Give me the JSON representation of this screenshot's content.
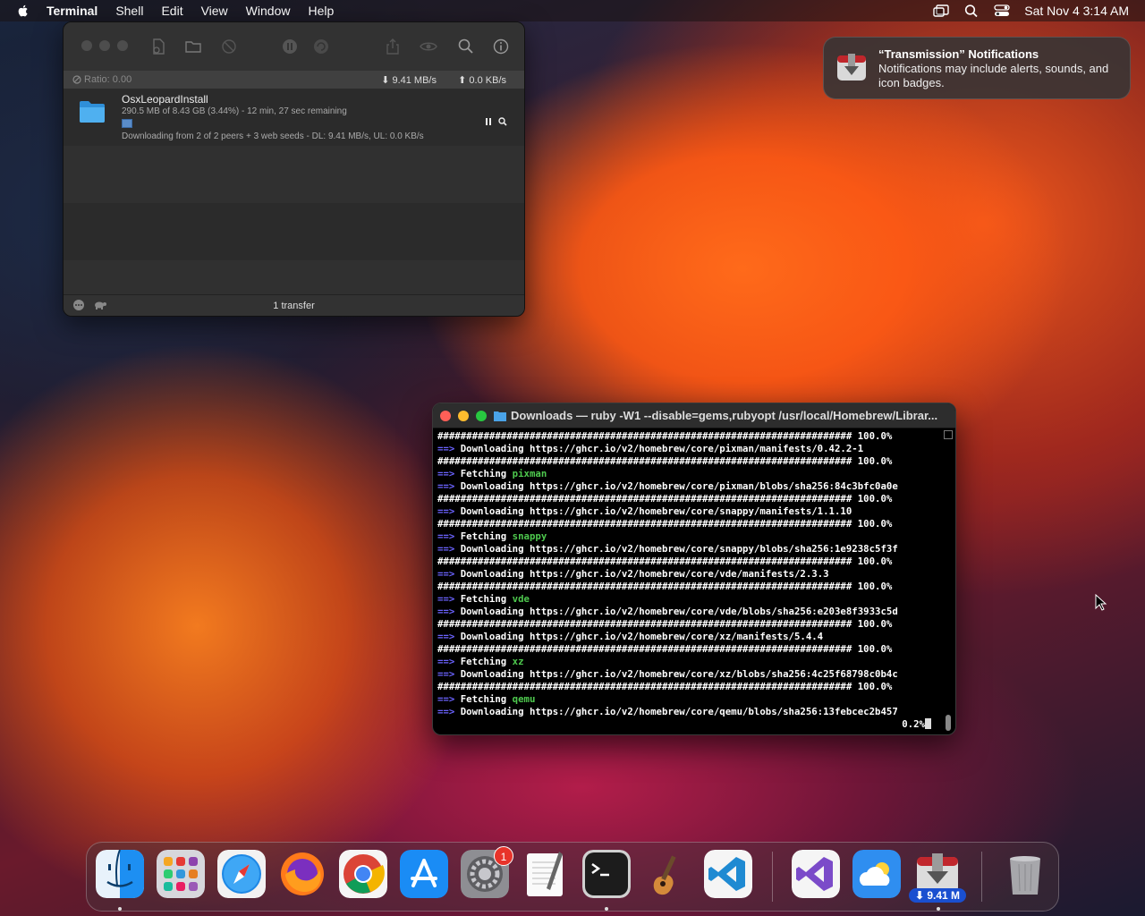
{
  "menubar": {
    "app_name": "Terminal",
    "menus": [
      "Shell",
      "Edit",
      "View",
      "Window",
      "Help"
    ],
    "datetime": "Sat Nov 4  3:14 AM"
  },
  "transmission": {
    "ratio": "Ratio: 0.00",
    "download_speed": "9.41 MB/s",
    "upload_speed": "0.0 KB/s",
    "torrent": {
      "name": "OsxLeopardInstall",
      "progress_text": "290.5 MB of 8.43 GB (3.44%) - 12 min, 27 sec remaining",
      "progress_fraction": 0.0344,
      "status_text": "Downloading from 2 of 2 peers + 3 web seeds - DL: 9.41 MB/s, UL: 0.0 KB/s"
    },
    "footer_count": "1 transfer"
  },
  "notification": {
    "title": "“Transmission” Notifications",
    "body": "Notifications may include alerts, sounds, and icon badges."
  },
  "terminal": {
    "title": "Downloads — ruby -W1 --disable=gems,rubyopt /usr/local/Homebrew/Librar...",
    "lines": [
      {
        "kind": "hash",
        "text": "######################################################################## 100.0%"
      },
      {
        "kind": "arrow",
        "text": "Downloading https://ghcr.io/v2/homebrew/core/pixman/manifests/0.42.2-1"
      },
      {
        "kind": "hash",
        "text": "######################################################################## 100.0%"
      },
      {
        "kind": "fetch",
        "text": "Fetching ",
        "pkg": "pixman"
      },
      {
        "kind": "arrow",
        "text": "Downloading https://ghcr.io/v2/homebrew/core/pixman/blobs/sha256:84c3bfc0a0e"
      },
      {
        "kind": "hash",
        "text": "######################################################################## 100.0%"
      },
      {
        "kind": "arrow",
        "text": "Downloading https://ghcr.io/v2/homebrew/core/snappy/manifests/1.1.10"
      },
      {
        "kind": "hash",
        "text": "######################################################################## 100.0%"
      },
      {
        "kind": "fetch",
        "text": "Fetching ",
        "pkg": "snappy"
      },
      {
        "kind": "arrow",
        "text": "Downloading https://ghcr.io/v2/homebrew/core/snappy/blobs/sha256:1e9238c5f3f"
      },
      {
        "kind": "hash",
        "text": "######################################################################## 100.0%"
      },
      {
        "kind": "arrow",
        "text": "Downloading https://ghcr.io/v2/homebrew/core/vde/manifests/2.3.3"
      },
      {
        "kind": "hash",
        "text": "######################################################################## 100.0%"
      },
      {
        "kind": "fetch",
        "text": "Fetching ",
        "pkg": "vde"
      },
      {
        "kind": "arrow",
        "text": "Downloading https://ghcr.io/v2/homebrew/core/vde/blobs/sha256:e203e8f3933c5d"
      },
      {
        "kind": "hash",
        "text": "######################################################################## 100.0%"
      },
      {
        "kind": "arrow",
        "text": "Downloading https://ghcr.io/v2/homebrew/core/xz/manifests/5.4.4"
      },
      {
        "kind": "hash",
        "text": "######################################################################## 100.0%"
      },
      {
        "kind": "fetch",
        "text": "Fetching ",
        "pkg": "xz"
      },
      {
        "kind": "arrow",
        "text": "Downloading https://ghcr.io/v2/homebrew/core/xz/blobs/sha256:4c25f68798c0b4c"
      },
      {
        "kind": "hash",
        "text": "######################################################################## 100.0%"
      },
      {
        "kind": "fetch",
        "text": "Fetching ",
        "pkg": "qemu"
      },
      {
        "kind": "arrow",
        "text": "Downloading https://ghcr.io/v2/homebrew/core/qemu/blobs/sha256:13febcec2b457"
      }
    ],
    "arrow_prefix": "==> ",
    "progress": "0.2%"
  },
  "dock": {
    "apps": [
      "finder-icon",
      "launchpad-icon",
      "safari-icon",
      "firefox-icon",
      "chrome-icon",
      "app-store-icon",
      "system-settings-icon",
      "textedit-icon",
      "terminal-icon",
      "garageband-icon",
      "vscode-icon",
      "visual-studio-icon",
      "weather-icon",
      "transmission-icon",
      "trash-icon"
    ],
    "settings_badge": "1",
    "transmission_badge": "⬇ 9.41 M"
  }
}
